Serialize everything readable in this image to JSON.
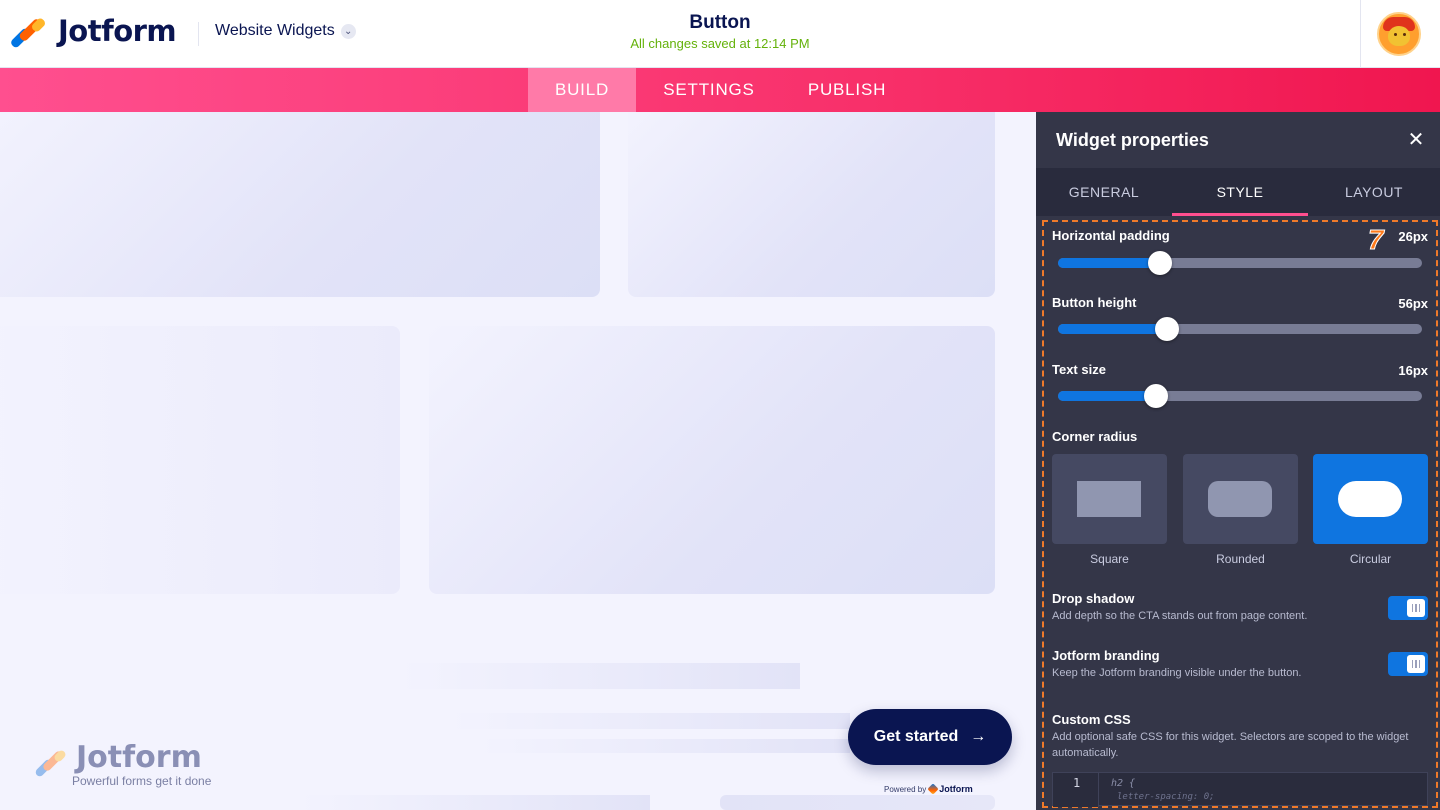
{
  "header": {
    "brand": "Jotform",
    "breadcrumb": "Website Widgets",
    "page_title": "Button",
    "save_status": "All changes saved at 12:14 PM"
  },
  "nav": {
    "tabs": [
      {
        "label": "BUILD",
        "active": true
      },
      {
        "label": "SETTINGS",
        "active": false
      },
      {
        "label": "PUBLISH",
        "active": false
      }
    ],
    "accent_color": "#f8306a"
  },
  "canvas": {
    "watermark_brand": "Jotform",
    "watermark_tagline": "Powerful forms get it done",
    "cta_label": "Get started",
    "powered_by_text": "Powered by",
    "powered_by_brand": "Jotform"
  },
  "panel": {
    "title": "Widget properties",
    "tabs": [
      {
        "label": "GENERAL",
        "active": false
      },
      {
        "label": "STYLE",
        "active": true
      },
      {
        "label": "LAYOUT",
        "active": false
      }
    ],
    "step_badge": "7",
    "sliders": [
      {
        "label": "Horizontal padding",
        "value": "26px",
        "fraction": 0.28
      },
      {
        "label": "Button height",
        "value": "56px",
        "fraction": 0.3
      },
      {
        "label": "Text size",
        "value": "16px",
        "fraction": 0.27
      }
    ],
    "corner_radius": {
      "label": "Corner radius",
      "options": [
        {
          "label": "Square",
          "selected": false
        },
        {
          "label": "Rounded",
          "selected": false
        },
        {
          "label": "Circular",
          "selected": true
        }
      ]
    },
    "drop_shadow": {
      "label": "Drop shadow",
      "description": "Add depth so the CTA stands out from page content.",
      "enabled": true
    },
    "branding": {
      "label": "Jotform branding",
      "description": "Keep the Jotform branding visible under the button.",
      "enabled": true
    },
    "custom_css": {
      "label": "Custom CSS",
      "description": "Add optional safe CSS for this widget. Selectors are scoped to the widget automatically.",
      "line_number": "1",
      "line1": "h2 {",
      "line2": "letter-spacing: 0;"
    },
    "colors": {
      "primary": "#0f75e0",
      "panel_bg": "#343648",
      "highlight": "#ff7a1a"
    }
  }
}
